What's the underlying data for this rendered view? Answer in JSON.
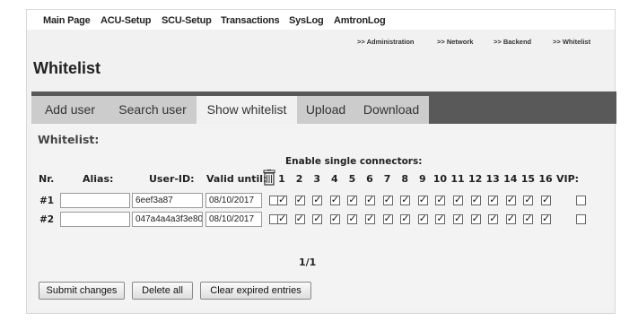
{
  "top_nav": [
    "Main Page",
    "ACU-Setup",
    "SCU-Setup",
    "Transactions",
    "SysLog",
    "AmtronLog"
  ],
  "breadcrumbs": [
    ">> Administration",
    ">> Network",
    ">> Backend",
    ">> Whitelist"
  ],
  "page_title": "Whitelist",
  "tabs": [
    {
      "label": "Add user",
      "active": false
    },
    {
      "label": "Search user",
      "active": false
    },
    {
      "label": "Show whitelist",
      "active": true
    },
    {
      "label": "Upload",
      "active": false
    },
    {
      "label": "Download",
      "active": false
    }
  ],
  "subheading": "Whitelist:",
  "enable_label": "Enable single connectors:",
  "columns": {
    "nr": "Nr.",
    "alias": "Alias:",
    "user_id": "User-ID:",
    "valid_until": "Valid until:",
    "connectors": [
      "1",
      "2",
      "3",
      "4",
      "5",
      "6",
      "7",
      "8",
      "9",
      "10",
      "11",
      "12",
      "13",
      "14",
      "15",
      "16"
    ],
    "vip": "VIP:"
  },
  "rows": [
    {
      "nr": "#1",
      "alias": "",
      "user_id": "6eef3a87",
      "valid_until": "08/10/2017",
      "trash_checked": false,
      "connectors": [
        true,
        true,
        true,
        true,
        true,
        true,
        true,
        true,
        true,
        true,
        true,
        true,
        true,
        true,
        true,
        true
      ],
      "vip": false
    },
    {
      "nr": "#2",
      "alias": "",
      "user_id": "047a4a4a3f3e80",
      "valid_until": "08/10/2017",
      "trash_checked": false,
      "connectors": [
        true,
        true,
        true,
        true,
        true,
        true,
        true,
        true,
        true,
        true,
        true,
        true,
        true,
        true,
        true,
        true
      ],
      "vip": false
    }
  ],
  "pager": "1/1",
  "buttons": {
    "submit": "Submit changes",
    "delete_all": "Delete all",
    "clear_expired": "Clear expired entries"
  },
  "icons": {
    "delete_column": "trash-icon"
  }
}
